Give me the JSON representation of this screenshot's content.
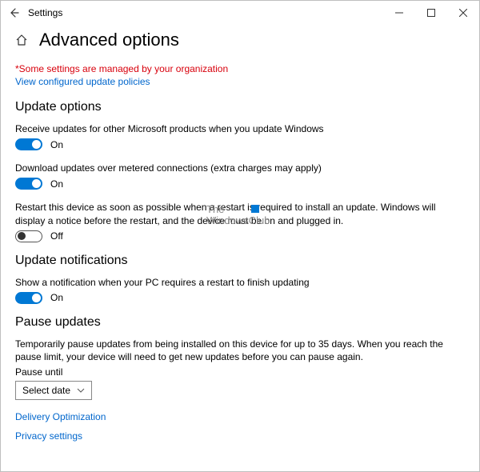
{
  "titlebar": {
    "app": "Settings"
  },
  "header": {
    "title": "Advanced options"
  },
  "notice": {
    "org": "*Some settings are managed by your organization",
    "policies": "View configured update policies"
  },
  "sections": {
    "update_options": {
      "heading": "Update options",
      "opt1": {
        "label": "Receive updates for other Microsoft products when you update Windows",
        "state": "On"
      },
      "opt2": {
        "label": "Download updates over metered connections (extra charges may apply)",
        "state": "On"
      },
      "opt3": {
        "label": "Restart this device as soon as possible when a restart is required to install an update. Windows will display a notice before the restart, and the device must be on and plugged in.",
        "state": "Off"
      }
    },
    "notifications": {
      "heading": "Update notifications",
      "opt1": {
        "label": "Show a notification when your PC requires a restart to finish updating",
        "state": "On"
      }
    },
    "pause": {
      "heading": "Pause updates",
      "desc": "Temporarily pause updates from being installed on this device for up to 35 days. When you reach the pause limit, your device will need to get new updates before you can pause again.",
      "until_label": "Pause until",
      "select_value": "Select date"
    }
  },
  "footer": {
    "delivery": "Delivery Optimization",
    "privacy": "Privacy settings"
  },
  "watermark": {
    "line1": "The",
    "line2": "WindowsClub"
  }
}
